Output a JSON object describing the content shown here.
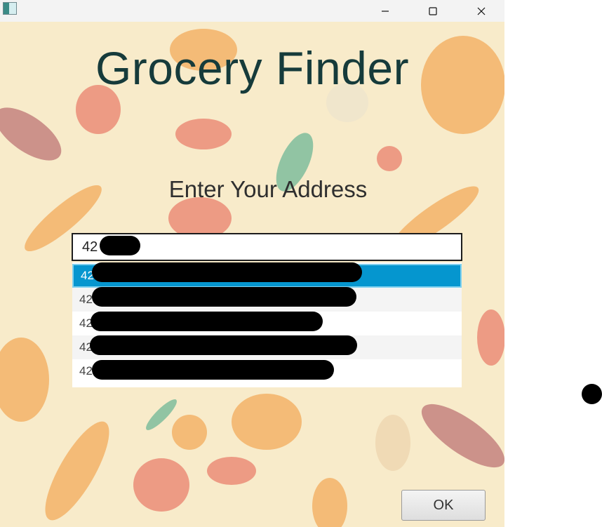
{
  "window": {
    "icon": "app-icon",
    "controls": [
      "minimize-icon",
      "maximize-icon",
      "close-icon"
    ]
  },
  "main": {
    "title": "Grocery Finder",
    "subtitle": "Enter Your Address",
    "address_value": "42",
    "suggestions": [
      {
        "prefix": "42",
        "selected": true
      },
      {
        "prefix": "42",
        "selected": false
      },
      {
        "prefix": "42",
        "selected": false
      },
      {
        "prefix": "42",
        "selected": false
      },
      {
        "prefix": "42",
        "selected": false
      }
    ],
    "ok_label": "OK"
  },
  "colors": {
    "background": "#f8ebca",
    "title": "#163b3b",
    "selection": "#0596cf"
  }
}
